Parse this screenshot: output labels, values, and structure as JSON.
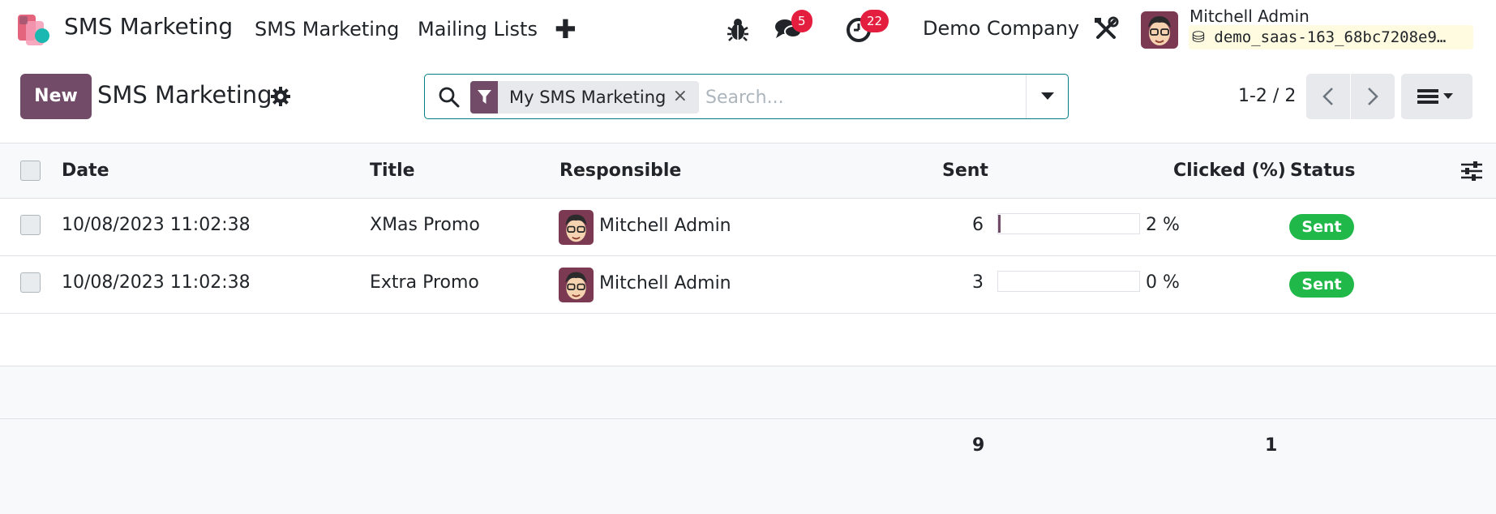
{
  "navbar": {
    "app_name": "SMS Marketing",
    "menus": [
      "SMS Marketing",
      "Mailing Lists"
    ],
    "messages_count": "5",
    "activities_count": "22",
    "company": "Demo Company",
    "user_name": "Mitchell Admin",
    "database": "demo_saas-163_68bc7208e9…"
  },
  "control_panel": {
    "new_label": "New",
    "title": "SMS Marketing",
    "search": {
      "facet": "My SMS Marketing",
      "facet_remove": "×",
      "placeholder": "Search..."
    },
    "pager": "1-2 / 2"
  },
  "list": {
    "columns": {
      "date": "Date",
      "title": "Title",
      "responsible": "Responsible",
      "sent": "Sent",
      "clicked": "Clicked (%)",
      "status": "Status"
    },
    "rows": [
      {
        "date": "10/08/2023 11:02:38",
        "title": "XMas Promo",
        "responsible": "Mitchell Admin",
        "sent": "6",
        "clicked_pct": 2,
        "clicked_label": "2 %",
        "status": "Sent"
      },
      {
        "date": "10/08/2023 11:02:38",
        "title": "Extra Promo",
        "responsible": "Mitchell Admin",
        "sent": "3",
        "clicked_pct": 0,
        "clicked_label": "0 %",
        "status": "Sent"
      }
    ],
    "totals": {
      "sent": "9",
      "clicked": "1"
    }
  },
  "colors": {
    "brand": "#714b67",
    "status_sent": "#21b84a",
    "badge": "#e41e3f",
    "search_border": "#017e84"
  }
}
